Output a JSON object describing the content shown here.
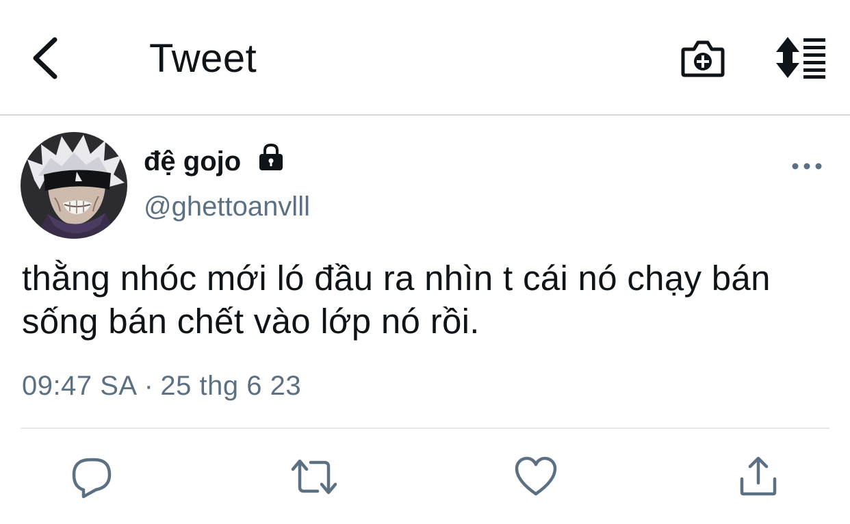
{
  "header": {
    "title": "Tweet",
    "back_icon": "chevron-left-icon",
    "camera_icon": "camera-add-icon",
    "sort_icon": "sort-lines-icon"
  },
  "tweet": {
    "display_name": "đệ gojo",
    "handle": "@ghettoanvlll",
    "protected_icon": "lock-icon",
    "text": "thằng nhóc mới ló đầu ra nhìn t cái nó chạy bán sống bán chết vào lớp nó rồi.",
    "time": "09:47 SA",
    "separator": "·",
    "date": "25 thg 6 23"
  },
  "actions": [
    {
      "name": "reply",
      "icon": "reply-icon"
    },
    {
      "name": "retweet",
      "icon": "retweet-icon"
    },
    {
      "name": "like",
      "icon": "heart-icon"
    },
    {
      "name": "share",
      "icon": "share-icon"
    }
  ],
  "colors": {
    "text": "#0f1419",
    "secondary": "#5b7083",
    "icon": "#5b7083",
    "divider": "#e6e9ec"
  }
}
